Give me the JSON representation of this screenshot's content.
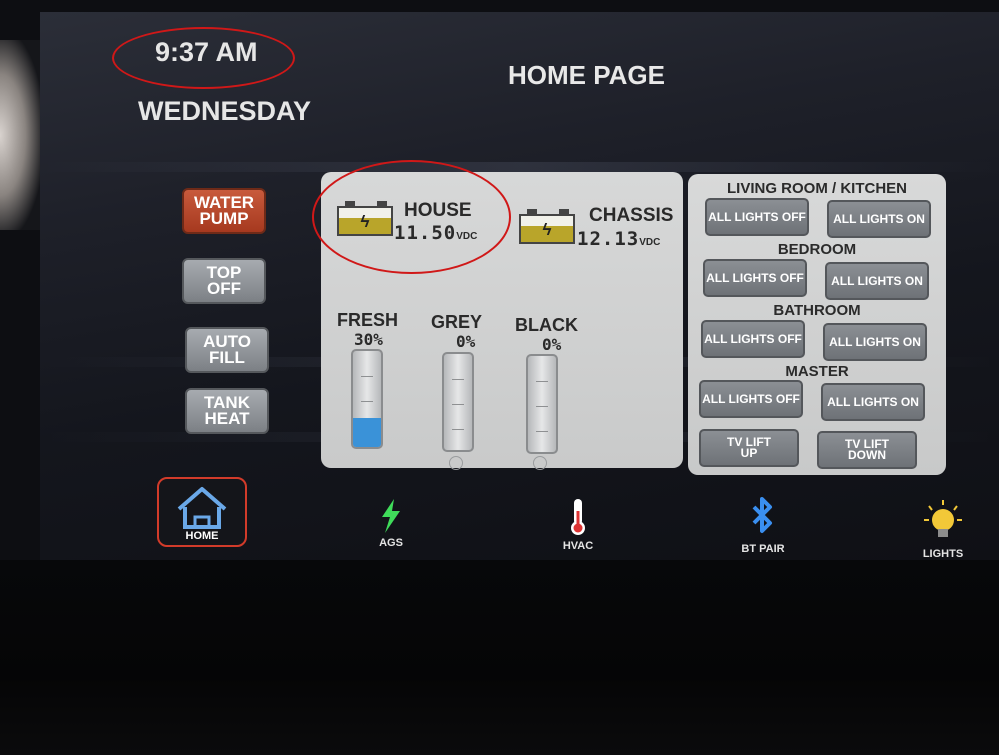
{
  "status": {
    "time": "9:37 AM",
    "day": "WEDNESDAY"
  },
  "page": {
    "title": "HOME PAGE"
  },
  "side_buttons": [
    {
      "label": "WATER\nPUMP",
      "active": true
    },
    {
      "label": "TOP\nOFF",
      "active": false
    },
    {
      "label": "AUTO\nFILL",
      "active": false
    },
    {
      "label": "TANK\nHEAT",
      "active": false
    }
  ],
  "batteries": {
    "house": {
      "name": "HOUSE",
      "voltage": "11.50",
      "unit": "VDC",
      "icon": "battery-charging-icon"
    },
    "chassis": {
      "name": "CHASSIS",
      "voltage": "12.13",
      "unit": "VDC",
      "icon": "battery-charging-icon"
    }
  },
  "tanks": {
    "fresh": {
      "name": "FRESH",
      "percent": "30%",
      "level": 0.3
    },
    "grey": {
      "name": "GREY",
      "percent": "0%",
      "level": 0
    },
    "black": {
      "name": "BLACK",
      "percent": "0%",
      "level": 0
    }
  },
  "lighting": {
    "rooms": [
      {
        "name": "LIVING ROOM / KITCHEN",
        "off": "ALL LIGHTS OFF",
        "on": "ALL LIGHTS ON"
      },
      {
        "name": "BEDROOM",
        "off": "ALL LIGHTS OFF",
        "on": "ALL LIGHTS ON"
      },
      {
        "name": "BATHROOM",
        "off": "ALL LIGHTS OFF",
        "on": "ALL LIGHTS ON"
      },
      {
        "name": "MASTER",
        "off": "ALL LIGHTS OFF",
        "on": "ALL LIGHTS ON"
      }
    ],
    "tv_lift": {
      "up": "TV LIFT\nUP",
      "down": "TV LIFT\nDOWN"
    }
  },
  "nav": [
    {
      "label": "HOME",
      "icon": "home-icon",
      "active": true
    },
    {
      "label": "AGS",
      "icon": "lightning-bolt-icon"
    },
    {
      "label": "HVAC",
      "icon": "thermometer-icon"
    },
    {
      "label": "BT PAIR",
      "icon": "bluetooth-icon"
    },
    {
      "label": "LIGHTS",
      "icon": "light-bulb-icon"
    }
  ],
  "colors": {
    "accent_red": "#d01818",
    "water_pump_active": "#b8432a",
    "battery_fill": "#b9a52a",
    "fresh_water": "#3a92d8",
    "ags_green": "#3fdc5a",
    "bluetooth_blue": "#3a8ff0",
    "bulb_yellow": "#f2c838"
  }
}
